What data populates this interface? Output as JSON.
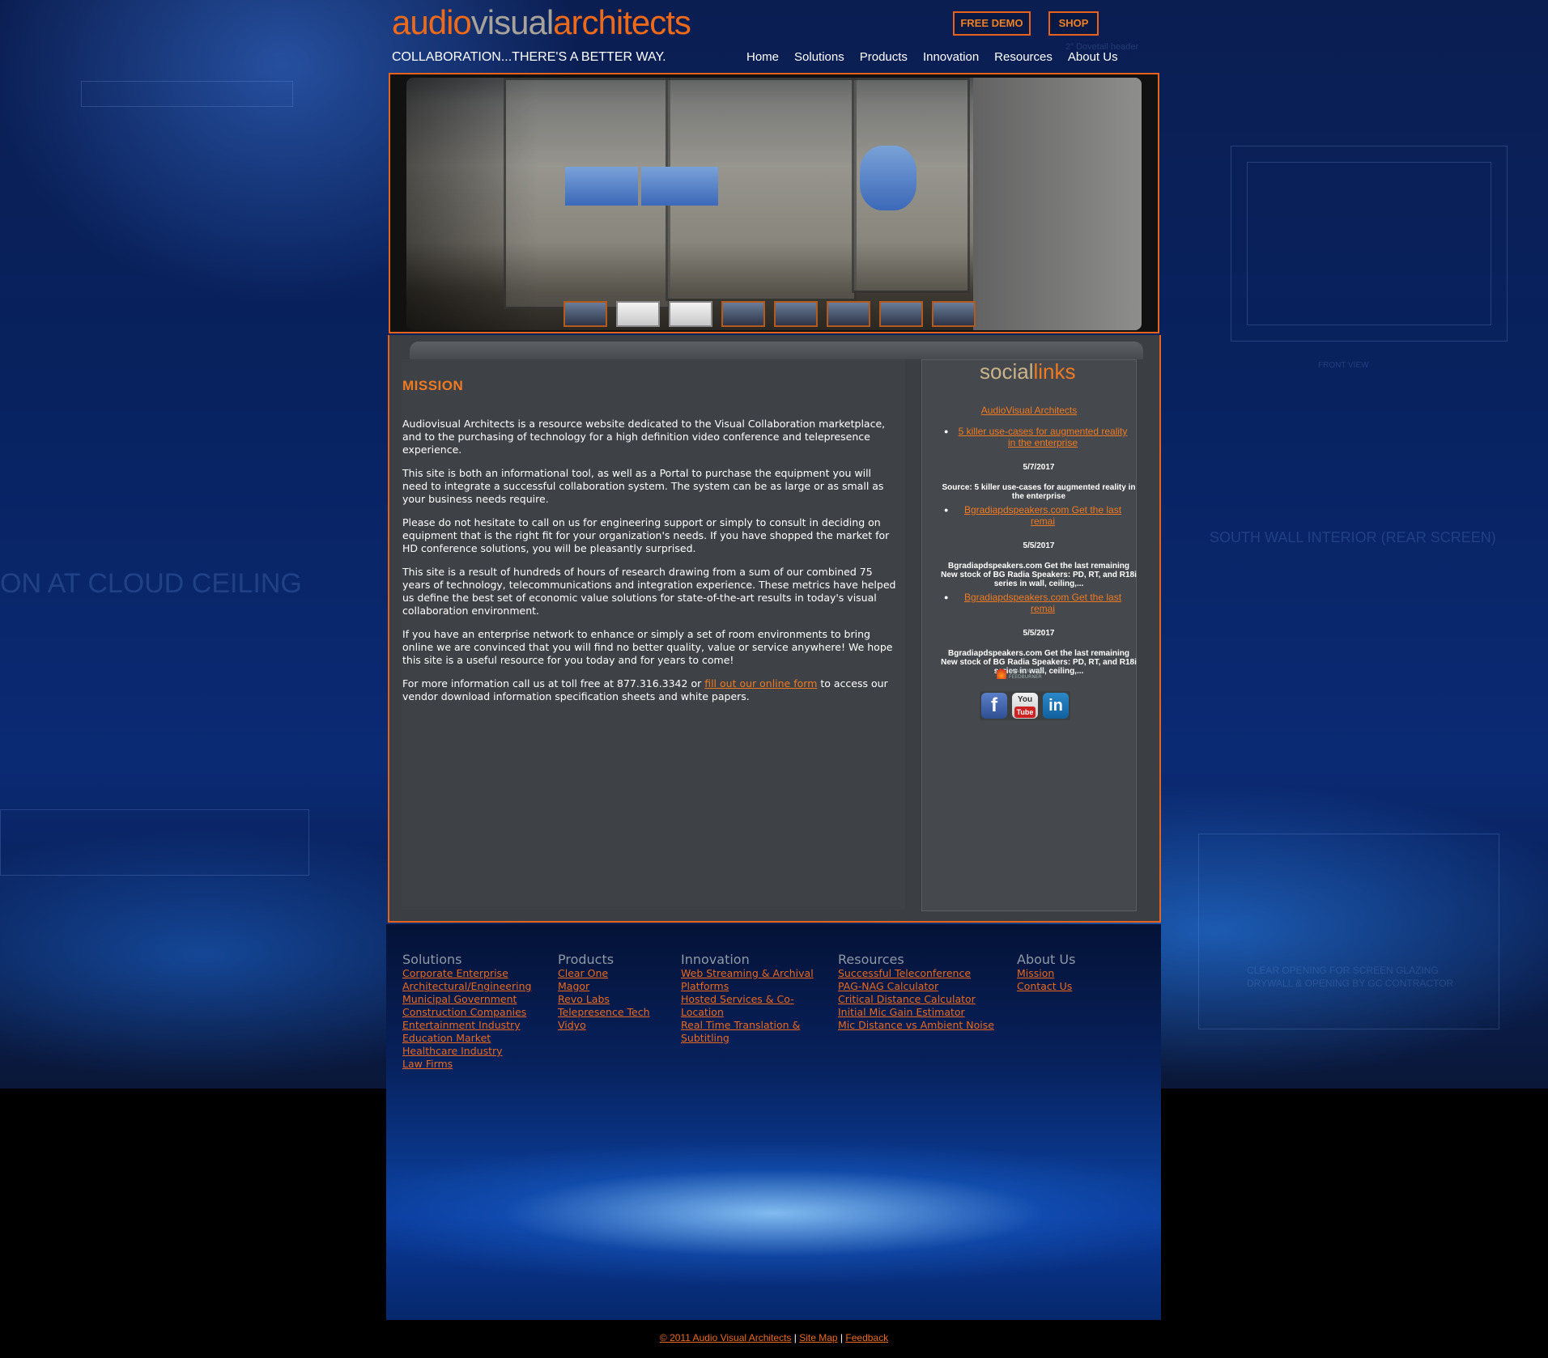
{
  "header": {
    "logo": {
      "part1": "audio",
      "part2": "visual",
      "part3": "architects"
    },
    "tagline": "COLLABORATION...THERE'S A BETTER WAY.",
    "buttons": {
      "demo": "FREE DEMO",
      "shop": "SHOP"
    },
    "nav": [
      "Home",
      "Solutions",
      "Products",
      "Innovation",
      "Resources",
      "About Us"
    ]
  },
  "background": {
    "texts": [
      "ON AT CLOUD CEILING",
      "SOUTH WALL INTERIOR (REAR SCREEN)",
      "FRONT VIEW",
      "CLEAR OPENING FOR SCREEN GLAZING",
      "DRYWALL & OPENING BY GC CONTRACTOR",
      "2\" Dovetail header"
    ]
  },
  "hero": {
    "thumbnail_count": 8
  },
  "mission": {
    "heading": "MISSION",
    "p1": "Audiovisual Architects is a resource website dedicated to the Visual Collaboration marketplace, and to the purchasing of technology for a high definition video conference and telepresence experience.",
    "p2": "This site is both an informational tool, as well as a Portal to purchase the equipment you will need to integrate a successful collaboration system. The system can be as large or as small as your business needs require.",
    "p3": "Please do not hesitate to call on us for engineering support or simply to consult in deciding on equipment that is the right fit for your organization's needs. If you have shopped the market for HD conference solutions, you will be pleasantly surprised.",
    "p4": "This site is a result of hundreds of hours of research drawing from a sum of our combined 75 years of technology, telecommunications and integration experience. These metrics have helped us define the best set of economic value solutions for state-of-the-art results in today's visual collaboration environment.",
    "p5": "If you have an enterprise network to enhance or simply a set of room environments to bring online we are convinced that you will find no better quality, value or service anywhere! We hope this site is a useful resource for you today and for years to come!",
    "p6_before": "For more information call us at toll free at 877.316.3342 or ",
    "p6_link": "fill out our online form",
    "p6_after": " to access our vendor download information specification sheets and white papers."
  },
  "social": {
    "heading_part1": "social",
    "heading_part2": "links",
    "feed_title": "AudioVisual Architects",
    "items": [
      {
        "title": "5 killer use-cases for augmented reality in the enterprise",
        "date": "5/7/2017",
        "summary": "Source: 5 killer use-cases for augmented reality in the enterprise"
      },
      {
        "title": "Bgradiapdspeakers.com Get the last remai",
        "date": "5/5/2017",
        "summary": "Bgradiapdspeakers.com Get the last remaining New stock of BG Radia Speakers: PD, RT, and R18i series in wall, ceiling,..."
      },
      {
        "title": "Bgradiapdspeakers.com Get the last remai",
        "date": "5/5/2017",
        "summary": "Bgradiapdspeakers.com Get the last remaining New stock of BG Radia Speakers: PD, RT, and R18i series in wall, ceiling,..."
      }
    ],
    "feedburner": "HEADLINES BY FEEDBURNER",
    "icons": {
      "facebook": "f",
      "youtube_top": "You",
      "youtube_bottom": "Tube",
      "linkedin": "in"
    }
  },
  "footer": {
    "columns": [
      {
        "heading": "Solutions",
        "links": [
          "Corporate Enterprise",
          "Architectural/Engineering",
          "Municipal Government",
          "Construction Companies",
          "Entertainment Industry",
          "Education Market",
          "Healthcare Industry",
          "Law Firms"
        ]
      },
      {
        "heading": "Products",
        "links": [
          "Clear One",
          "Magor",
          "Revo Labs",
          "Telepresence Tech",
          "Vidyo"
        ]
      },
      {
        "heading": "Innovation",
        "links": [
          "Web Streaming & Archival Platforms",
          "Hosted Services & Co-Location",
          "Real Time Translation & Subtitling"
        ]
      },
      {
        "heading": "Resources",
        "links": [
          "Successful Teleconference",
          "PAG-NAG Calculator",
          "Critical Distance Calculator",
          "Initial Mic Gain Estimator",
          "Mic Distance vs Ambient Noise"
        ]
      },
      {
        "heading": "About Us",
        "links": [
          "Mission",
          "Contact Us"
        ]
      }
    ],
    "copyright": "© 2011 Audio Visual Architects",
    "sitemap": "Site Map",
    "feedback": "Feedback",
    "separator": "|"
  },
  "colors": {
    "accent": "#e7621a",
    "panel": "#3b3f43",
    "background": "#08225f"
  }
}
